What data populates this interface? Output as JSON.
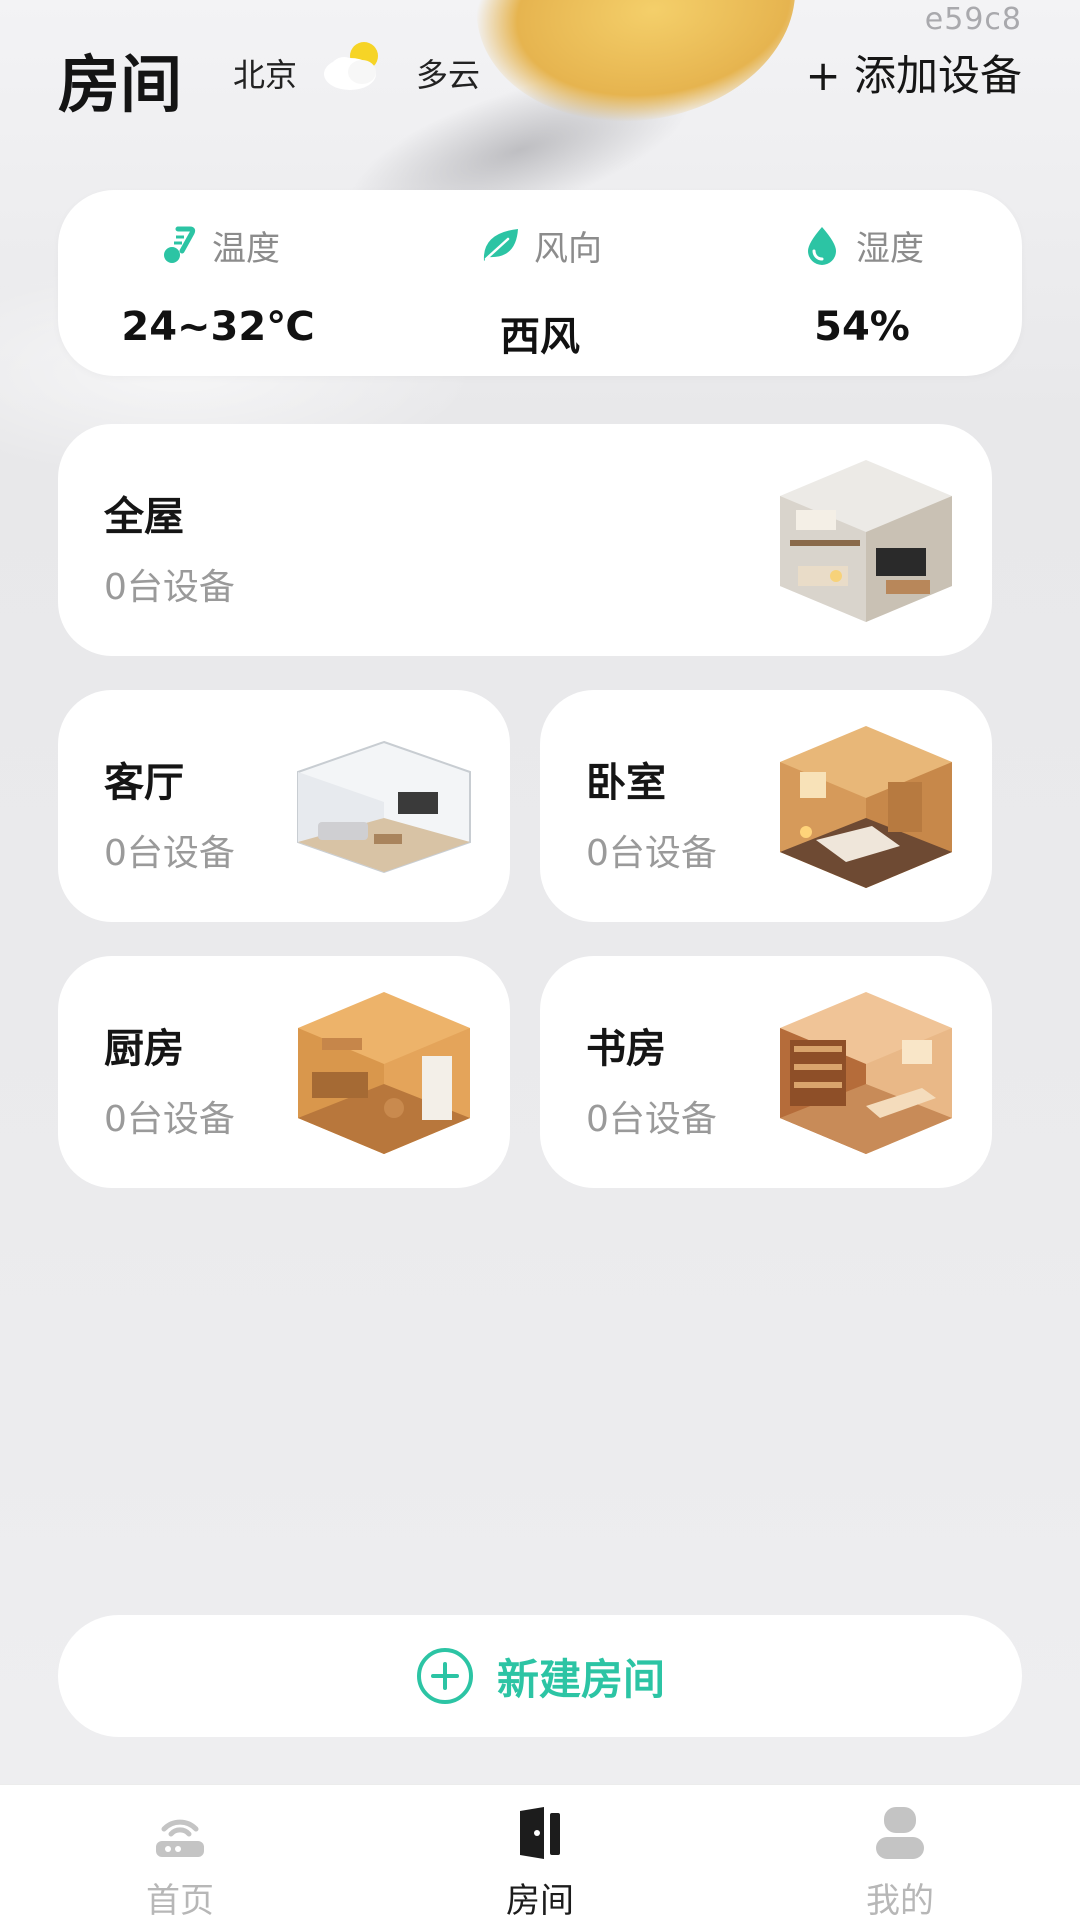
{
  "overlay_code": "e59c8",
  "header": {
    "title": "房间",
    "city": "北京",
    "weather_icon": "partly-cloudy-icon",
    "weather": "多云",
    "add_device_label": "+ 添加设备"
  },
  "climate": [
    {
      "icon": "thermometer-icon",
      "label": "温度",
      "value": "24~32℃"
    },
    {
      "icon": "leaf-icon",
      "label": "风向",
      "value": "西风"
    },
    {
      "icon": "water-drop-icon",
      "label": "湿度",
      "value": "54%"
    }
  ],
  "rooms": {
    "whole": {
      "name": "全屋",
      "count": "0台设备"
    },
    "living": {
      "name": "客厅",
      "count": "0台设备"
    },
    "bedroom": {
      "name": "卧室",
      "count": "0台设备"
    },
    "kitchen": {
      "name": "厨房",
      "count": "0台设备"
    },
    "study": {
      "name": "书房",
      "count": "0台设备"
    }
  },
  "new_room": {
    "label": "新建房间",
    "icon": "plus-circle-icon"
  },
  "nav": [
    {
      "label": "首页",
      "icon": "router-icon",
      "active": false
    },
    {
      "label": "房间",
      "icon": "door-icon",
      "active": true
    },
    {
      "label": "我的",
      "icon": "user-icon",
      "active": false
    }
  ],
  "colors": {
    "accent": "#2cc4a4",
    "text_primary": "#151515",
    "text_secondary": "#9a9a9a",
    "nav_inactive": "#b7b7b7"
  }
}
